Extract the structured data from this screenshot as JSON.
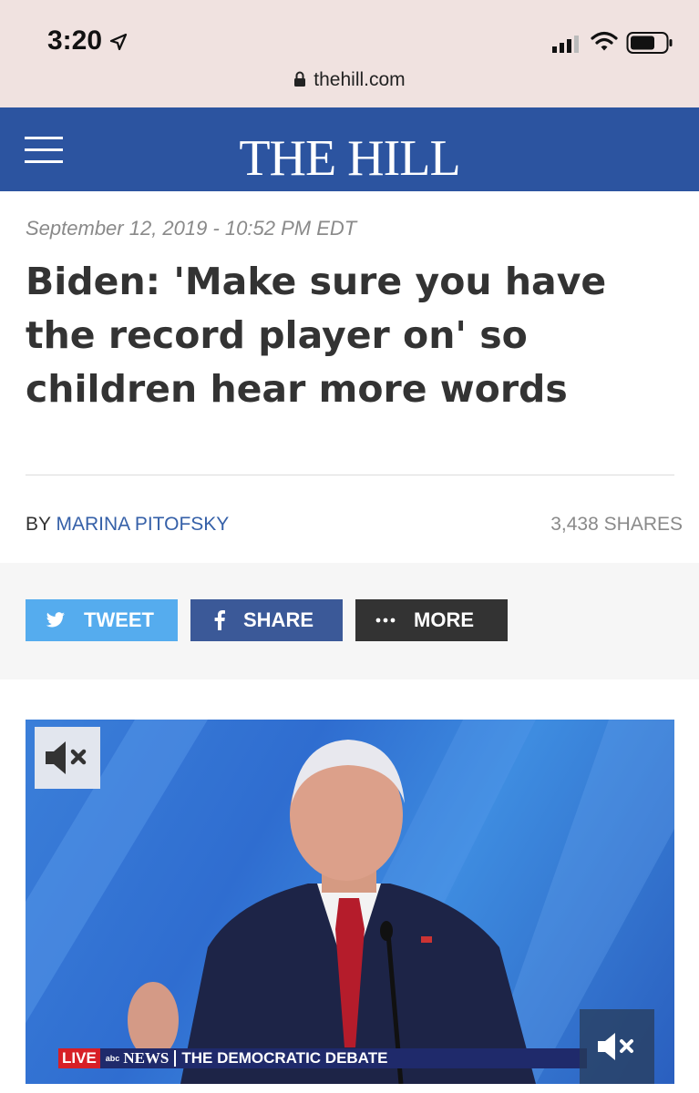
{
  "status_bar": {
    "time": "3:20",
    "url": "thehill.com",
    "icons": [
      "location-arrow-icon",
      "cellular-signal-icon",
      "wifi-icon",
      "battery-icon",
      "lock-icon"
    ]
  },
  "header": {
    "logo_text": "THE HILL",
    "background_color": "#2c54a0"
  },
  "article": {
    "dateline": "September 12, 2019 - 10:52 PM EDT",
    "headline": "Biden: 'Make sure you have the record player on' so children hear more words",
    "byline_prefix": "BY",
    "author": "MARINA PITOFSKY",
    "shares_count": "3,438",
    "shares_label": "SHARES"
  },
  "share_buttons": {
    "tweet": {
      "label": "TWEET",
      "color": "#55acee",
      "icon": "twitter-bird-icon"
    },
    "facebook": {
      "label": "SHARE",
      "color": "#3b5998",
      "icon": "facebook-f-icon"
    },
    "more": {
      "label": "MORE",
      "color": "#333333",
      "icon": "ellipsis-icon"
    }
  },
  "video": {
    "lower_third": {
      "live": "LIVE",
      "network": "NEWS",
      "title": "THE DEMOCRATIC DEBATE"
    },
    "icons": [
      "mute-icon",
      "mute-bottom-icon"
    ]
  }
}
